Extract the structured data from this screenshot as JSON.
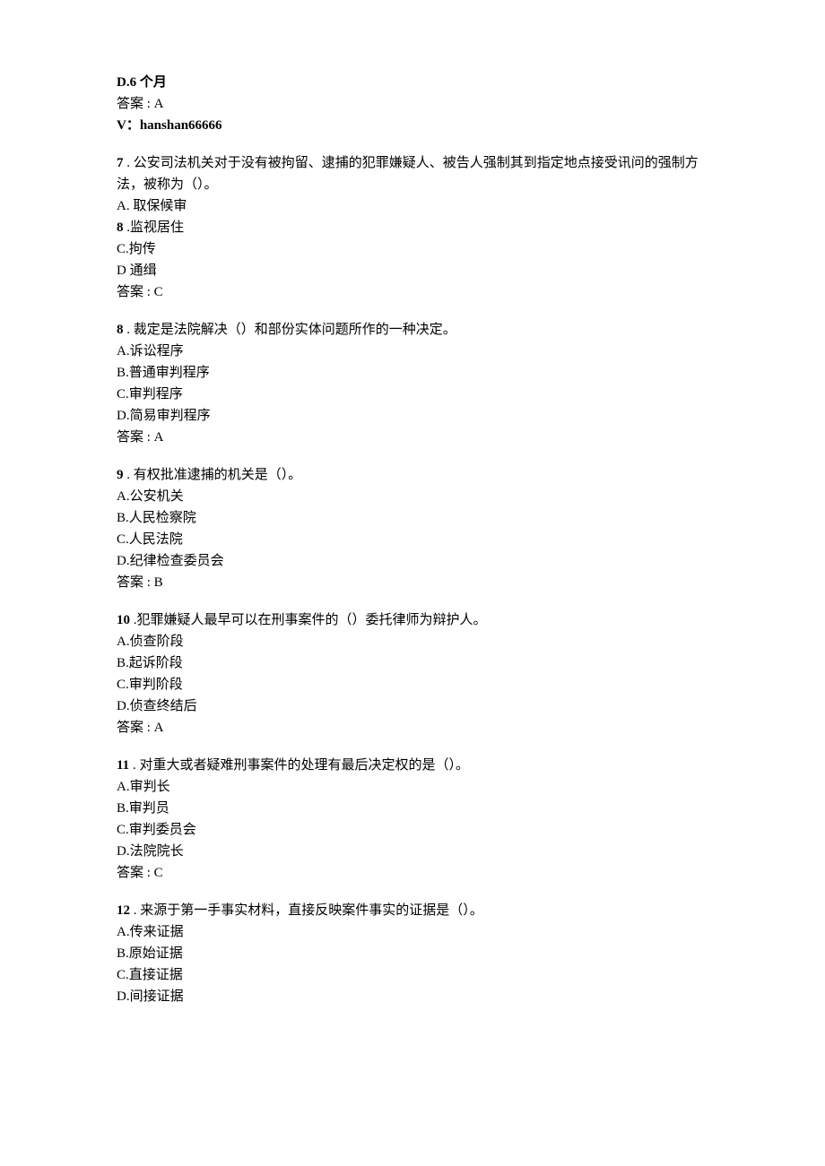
{
  "top": {
    "optionD": "D.6 个月",
    "answer": "答案 : A",
    "vline": "V：hanshan66666"
  },
  "q7": {
    "number": "7",
    "text": " . 公安司法机关对于没有被拘留、逮捕的犯罪嫌疑人、被告人强制其到指定地点接受讯问的强制方法，被称为（）。",
    "optA": "A. 取保候审",
    "optBnum": "8",
    "optBtext": " .监视居住",
    "optC": "C.拘传",
    "optD": "D 通缉",
    "answer": "答案 : C"
  },
  "q8": {
    "number": "8",
    "text": " . 裁定是法院解决（）和部份实体问题所作的一种决定。",
    "optA": "A.诉讼程序",
    "optB": "B.普通审判程序",
    "optC": "C.审判程序",
    "optD": "D.简易审判程序",
    "answer": "答案 : A"
  },
  "q9": {
    "number": "9",
    "text": " . 有权批准逮捕的机关是（）。",
    "optA": "A.公安机关",
    "optB": "B.人民检察院",
    "optC": "C.人民法院",
    "optD": "D.纪律检查委员会",
    "answer": "答案 : B"
  },
  "q10": {
    "number": "10",
    "text": "  .犯罪嫌疑人最早可以在刑事案件的（）委托律师为辩护人。",
    "optA": "A.侦查阶段",
    "optB": "B.起诉阶段",
    "optC": "C.审判阶段",
    "optD": "D.侦查终结后",
    "answer": "答案 : A"
  },
  "q11": {
    "number": "11",
    "text": "  . 对重大或者疑难刑事案件的处理有最后决定权的是（）。",
    "optA": "A.审判长",
    "optB": "B.审判员",
    "optC": "C.审判委员会",
    "optD": "D.法院院长",
    "answer": "答案 : C"
  },
  "q12": {
    "number": "12",
    "text": "  . 来源于第一手事实材料，直接反映案件事实的证据是（）。",
    "optA": "A.传来证据",
    "optB": "B.原始证据",
    "optC": "C.直接证据",
    "optD": "D.间接证据"
  }
}
